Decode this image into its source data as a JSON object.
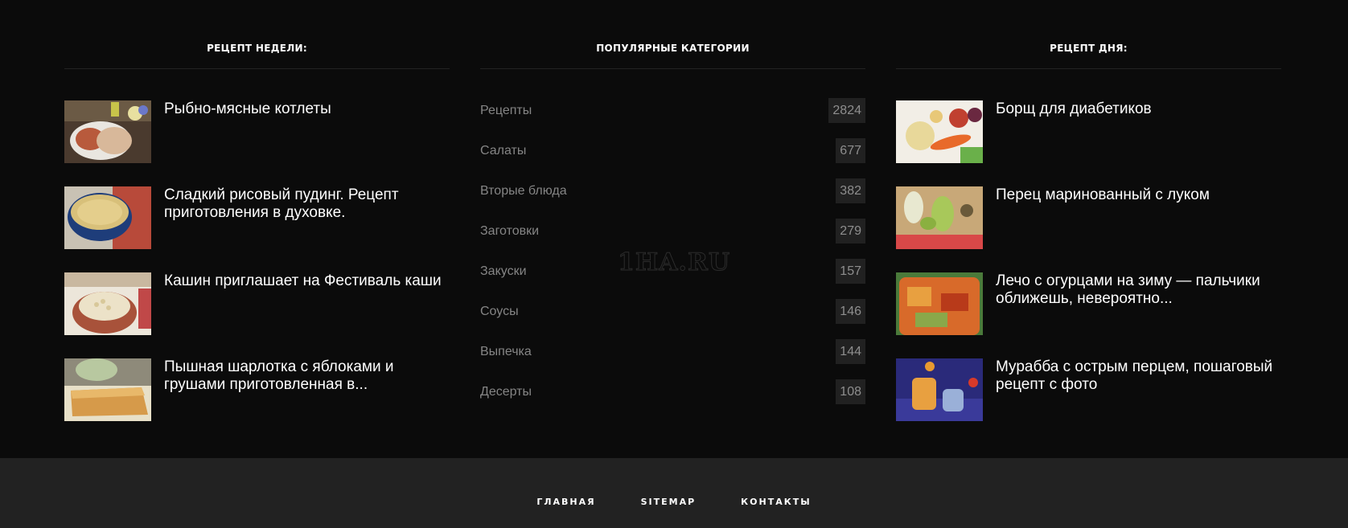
{
  "recipe_of_week": {
    "title": "РЕЦЕПТ НЕДЕЛИ:",
    "posts": [
      {
        "title": "Рыбно-мясные котлеты"
      },
      {
        "title": "Сладкий рисовый пудинг. Рецепт приготовления в духовке."
      },
      {
        "title": "Кашин приглашает на Фестиваль каши"
      },
      {
        "title": "Пышная шарлотка с яблоками и грушами приготовленная в..."
      }
    ]
  },
  "popular_categories": {
    "title": "ПОПУЛЯРНЫЕ КАТЕГОРИИ",
    "items": [
      {
        "name": "Рецепты",
        "count": "2824"
      },
      {
        "name": "Салаты",
        "count": "677"
      },
      {
        "name": "Вторые блюда",
        "count": "382"
      },
      {
        "name": "Заготовки",
        "count": "279"
      },
      {
        "name": "Закуски",
        "count": "157"
      },
      {
        "name": "Соусы",
        "count": "146"
      },
      {
        "name": "Выпечка",
        "count": "144"
      },
      {
        "name": "Десерты",
        "count": "108"
      }
    ]
  },
  "recipe_of_day": {
    "title": "РЕЦЕПТ ДНЯ:",
    "posts": [
      {
        "title": "Борщ для диабетиков"
      },
      {
        "title": "Перец маринованный с луком"
      },
      {
        "title": "Лечо с огурцами на зиму — пальчики оближешь, невероятно..."
      },
      {
        "title": "Мурабба с острым перцем, пошаговый рецепт с фото"
      }
    ]
  },
  "watermark": "1HA.RU",
  "footer": {
    "links": [
      "ГЛАВНАЯ",
      "SITEMAP",
      "КОНТАКТЫ"
    ]
  },
  "colors": {
    "background": "#0b0b0b",
    "footer_background": "#222222",
    "category_text": "#858585",
    "count_badge": "#212121"
  }
}
